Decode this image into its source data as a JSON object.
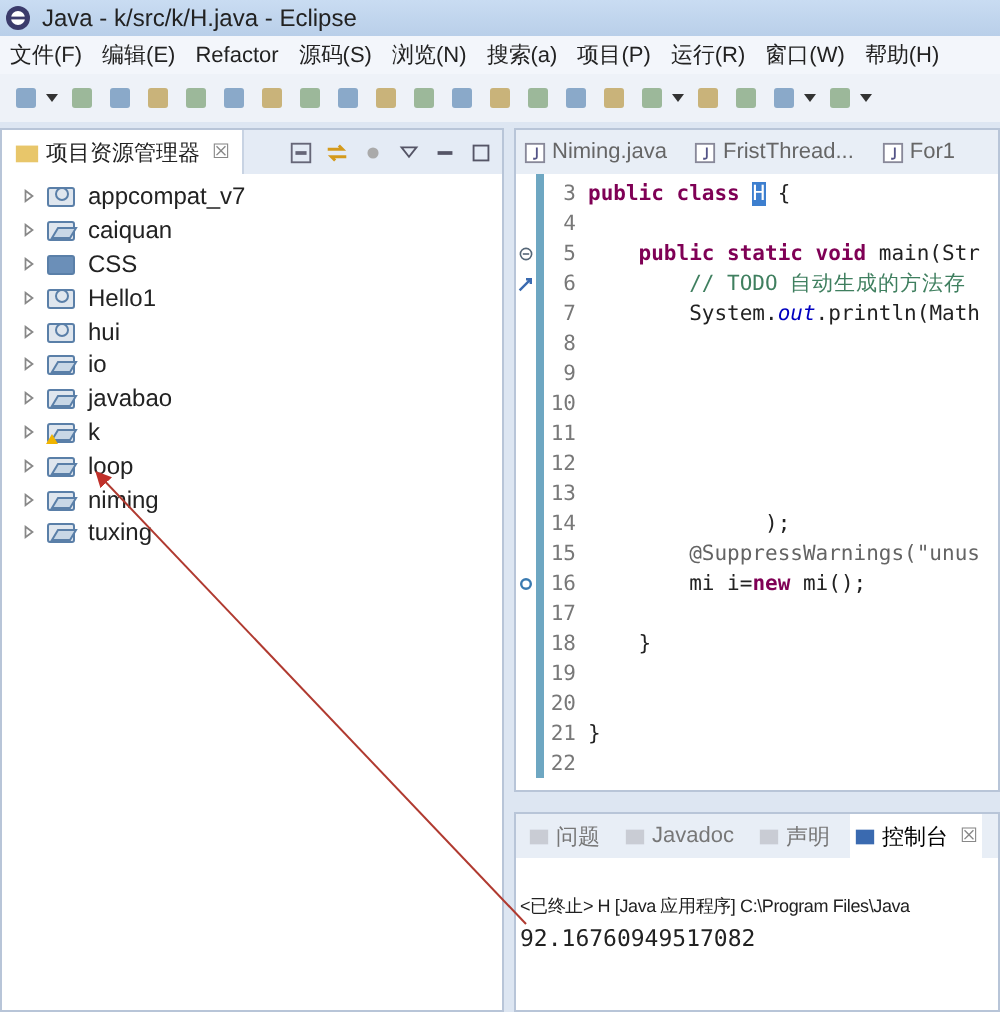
{
  "window": {
    "title": "Java  -  k/src/k/H.java  -  Eclipse"
  },
  "menu": [
    "文件(F)",
    "编辑(E)",
    "Refactor",
    "源码(S)",
    "浏览(N)",
    "搜索(a)",
    "项目(P)",
    "运行(R)",
    "窗口(W)",
    "帮助(H)"
  ],
  "explorer": {
    "title": "项目资源管理器",
    "close": "☒",
    "items": [
      {
        "name": "appcompat_v7",
        "kind": "android",
        "expanded": false
      },
      {
        "name": "caiquan",
        "kind": "java",
        "expanded": false
      },
      {
        "name": "CSS",
        "kind": "web",
        "expanded": false
      },
      {
        "name": "Hello1",
        "kind": "android",
        "expanded": false
      },
      {
        "name": "hui",
        "kind": "android",
        "expanded": false
      },
      {
        "name": "io",
        "kind": "java",
        "expanded": false
      },
      {
        "name": "javabao",
        "kind": "java",
        "expanded": false
      },
      {
        "name": "k",
        "kind": "warning",
        "expanded": false
      },
      {
        "name": "loop",
        "kind": "java",
        "expanded": false
      },
      {
        "name": "niming",
        "kind": "java",
        "expanded": false
      },
      {
        "name": "tuxing",
        "kind": "java",
        "expanded": false
      }
    ]
  },
  "editor_tabs": [
    {
      "label": "Niming.java",
      "selected": false
    },
    {
      "label": "FristThread...",
      "selected": false
    },
    {
      "label": "For1",
      "selected": false
    }
  ],
  "code_lines": [
    {
      "number": "3",
      "kind": "plain",
      "parts": [
        {
          "kind": "keyword",
          "text": "public class "
        },
        {
          "kind": "selected",
          "text": "H"
        },
        {
          "kind": "plain",
          "text": " {"
        }
      ]
    },
    {
      "number": "4",
      "kind": "plain"
    },
    {
      "number": "5",
      "kind": "fold",
      "parts": [
        {
          "kind": "keyword",
          "text": "    public static void"
        },
        {
          "kind": "plain",
          "text": " main(Str"
        }
      ]
    },
    {
      "number": "6",
      "kind": "task",
      "parts": [
        {
          "kind": "comment",
          "text": "        // TODO 自动生成的方法存"
        }
      ]
    },
    {
      "number": "7",
      "kind": "plain",
      "parts": [
        {
          "kind": "plain",
          "text": "        System."
        },
        {
          "kind": "field",
          "text": "out"
        },
        {
          "kind": "plain",
          "text": ".println(Math"
        }
      ]
    },
    {
      "number": "8",
      "kind": "plain"
    },
    {
      "number": "9",
      "kind": "plain"
    },
    {
      "number": "10",
      "kind": "plain"
    },
    {
      "number": "11",
      "kind": "plain"
    },
    {
      "number": "12",
      "kind": "plain"
    },
    {
      "number": "13",
      "kind": "plain"
    },
    {
      "number": "14",
      "kind": "plain",
      "parts": [
        {
          "kind": "plain",
          "text": "              );"
        }
      ]
    },
    {
      "number": "15",
      "kind": "plain",
      "parts": [
        {
          "kind": "annotation",
          "text": "        @SuppressWarnings(\"unus"
        }
      ]
    },
    {
      "number": "16",
      "kind": "warning",
      "parts": [
        {
          "kind": "plain",
          "text": "        mi i="
        },
        {
          "kind": "keyword",
          "text": "new"
        },
        {
          "kind": "plain",
          "text": " mi();"
        }
      ]
    },
    {
      "number": "17",
      "kind": "plain"
    },
    {
      "number": "18",
      "kind": "plain",
      "parts": [
        {
          "kind": "plain",
          "text": "    }"
        }
      ]
    },
    {
      "number": "19",
      "kind": "plain"
    },
    {
      "number": "20",
      "kind": "plain"
    },
    {
      "number": "21",
      "kind": "plain",
      "parts": [
        {
          "kind": "plain",
          "text": "}"
        }
      ]
    },
    {
      "number": "22",
      "kind": "plain"
    }
  ],
  "bottom_tabs": [
    {
      "label": "问题",
      "selected": false
    },
    {
      "label": "Javadoc",
      "selected": false
    },
    {
      "label": "声明",
      "selected": false
    },
    {
      "label": "控制台",
      "selected": true
    }
  ],
  "bottom_close": "☒",
  "console": {
    "header": "<已终止> H [Java 应用程序] C:\\Program Files\\Java",
    "output": "92.16760949517082"
  }
}
